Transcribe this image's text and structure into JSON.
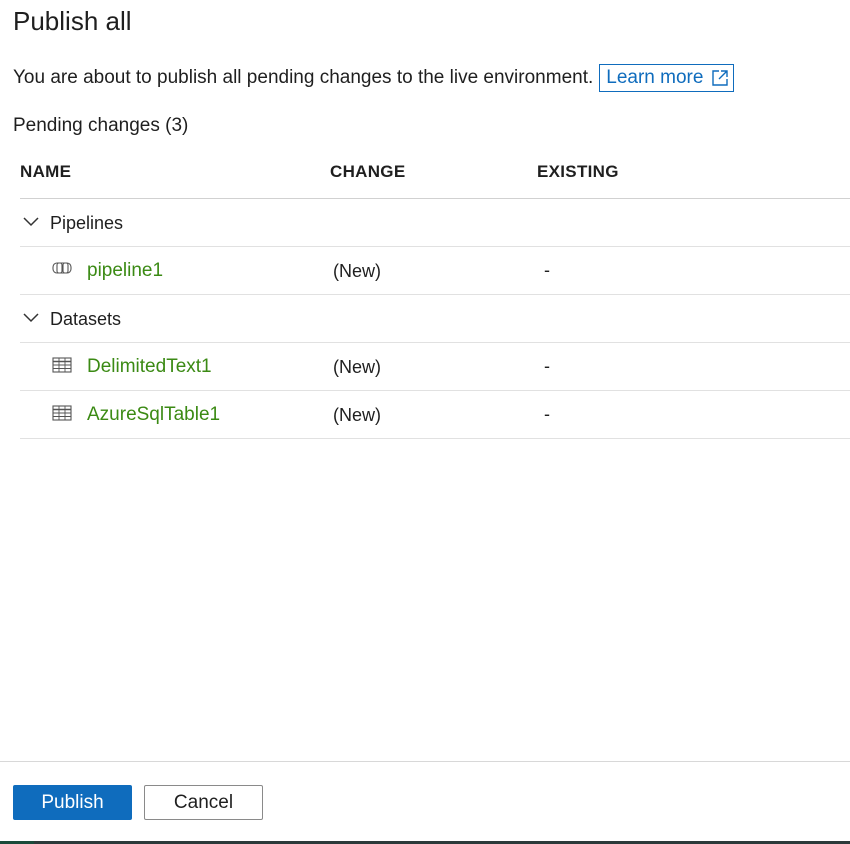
{
  "dialog": {
    "title": "Publish all",
    "description": "You are about to publish all pending changes to the live environment.",
    "learn_more": "Learn more",
    "pending_label": "Pending changes (3)"
  },
  "table": {
    "columns": {
      "name": "NAME",
      "change": "CHANGE",
      "existing": "EXISTING"
    },
    "groups": [
      {
        "label": "Pipelines",
        "items": [
          {
            "name": "pipeline1",
            "icon": "pipeline-icon",
            "change": "(New)",
            "existing": "-"
          }
        ]
      },
      {
        "label": "Datasets",
        "items": [
          {
            "name": "DelimitedText1",
            "icon": "table-icon",
            "change": "(New)",
            "existing": "-"
          },
          {
            "name": "AzureSqlTable1",
            "icon": "table-icon",
            "change": "(New)",
            "existing": "-"
          }
        ]
      }
    ]
  },
  "footer": {
    "publish_label": "Publish",
    "cancel_label": "Cancel"
  },
  "colors": {
    "accent": "#0f6cbd",
    "item_link": "#3b8a14"
  }
}
